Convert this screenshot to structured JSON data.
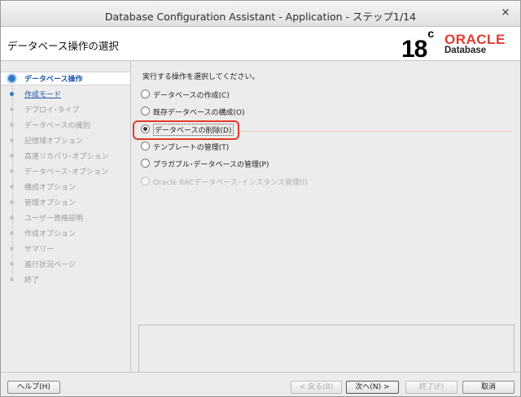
{
  "window": {
    "title": "Database Configuration Assistant - Application - ステップ1/14",
    "close_glyph": "×"
  },
  "header": {
    "step_title": "データベース操作の選択",
    "logo": {
      "version": "18",
      "version_sup": "c",
      "brand": "ORACLE",
      "product": "Database",
      "brand_color": "#e03c31"
    }
  },
  "nav": {
    "items": [
      {
        "label": "データベース操作",
        "state": "active"
      },
      {
        "label": "作成モード",
        "state": "next"
      },
      {
        "label": "デプロイ･タイプ",
        "state": "disabled"
      },
      {
        "label": "データベースの識別",
        "state": "disabled"
      },
      {
        "label": "記憶域オプション",
        "state": "disabled"
      },
      {
        "label": "高速リカバリ･オプション",
        "state": "disabled"
      },
      {
        "label": "データベース･オプション",
        "state": "disabled"
      },
      {
        "label": "構成オプション",
        "state": "disabled"
      },
      {
        "label": "管理オプション",
        "state": "disabled"
      },
      {
        "label": "ユーザー資格証明",
        "state": "disabled"
      },
      {
        "label": "作成オプション",
        "state": "disabled"
      },
      {
        "label": "サマリー",
        "state": "disabled"
      },
      {
        "label": "進行状況ページ",
        "state": "disabled"
      },
      {
        "label": "終了",
        "state": "disabled"
      }
    ]
  },
  "main": {
    "instruction": "実行する操作を選択してください。",
    "options": [
      {
        "label": "データベースの作成(C)",
        "selected": false,
        "enabled": true
      },
      {
        "label": "既存データベースの構成(O)",
        "selected": false,
        "enabled": true
      },
      {
        "label": "データベースの削除(D)",
        "selected": true,
        "enabled": true
      },
      {
        "label": "テンプレートの管理(T)",
        "selected": false,
        "enabled": true
      },
      {
        "label": "プラガブル･データベースの管理(P)",
        "selected": false,
        "enabled": true
      },
      {
        "label": "Oracle RACデータベース･インスタンス管理(I)",
        "selected": false,
        "enabled": false
      }
    ],
    "highlight_color": "#e23a2a"
  },
  "footer": {
    "help": "ヘルプ(H)",
    "back": "< 戻る(B)",
    "next": "次へ(N) >",
    "finish": "終了(F)",
    "cancel": "取消"
  },
  "colors": {
    "accent": "#2f7bc8",
    "nav_active_text": "#1d56a8"
  }
}
